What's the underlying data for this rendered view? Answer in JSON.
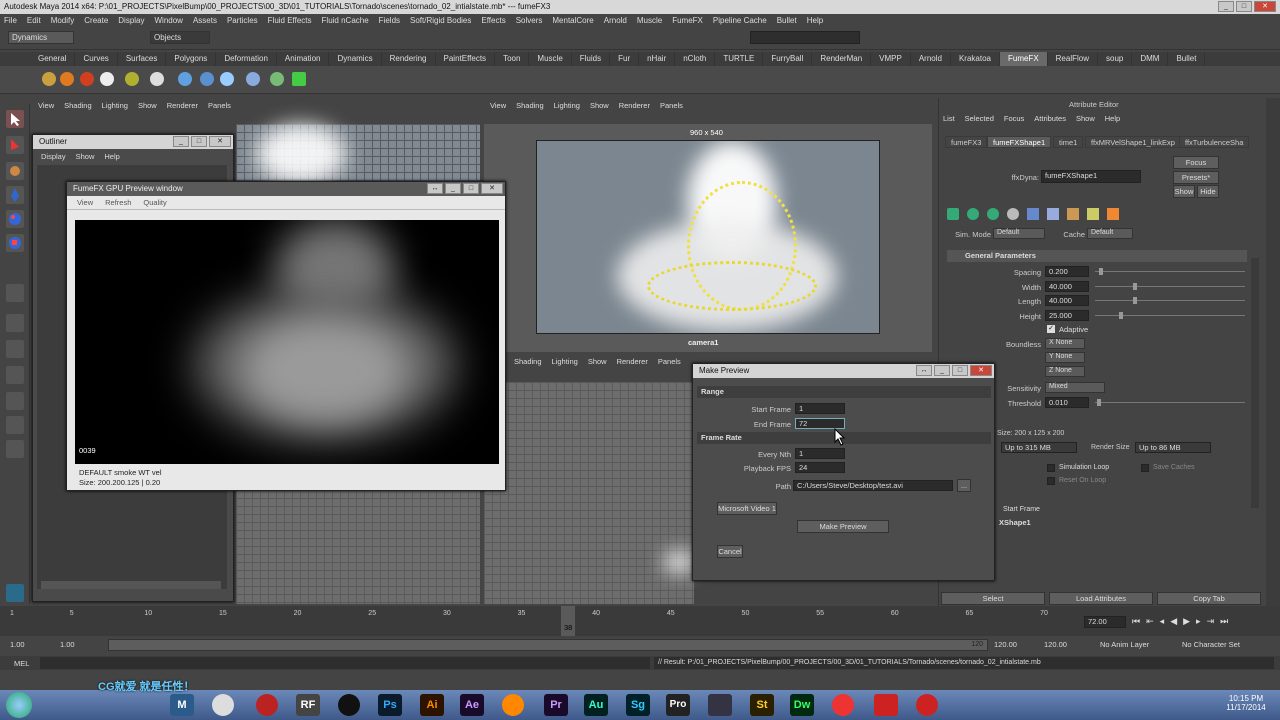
{
  "window_title": "Autodesk Maya 2014 x64: P:\\01_PROJECTS\\PixelBump\\00_PROJECTS\\00_3D\\01_TUTORIALS\\Tornado\\scenes\\tornado_02_intialstate.mb*  ---  fumeFX3",
  "menus": [
    "File",
    "Edit",
    "Modify",
    "Create",
    "Display",
    "Window",
    "Assets",
    "Particles",
    "Fluid Effects",
    "Fluid nCache",
    "Fields",
    "Soft/Rigid Bodies",
    "Effects",
    "Solvers",
    "MentalCore",
    "Arnold",
    "Muscle",
    "FumeFX",
    "Pipeline Cache",
    "Bullet",
    "Help"
  ],
  "status": {
    "menuset": "Dynamics",
    "selection_field": "Objects"
  },
  "shelf_tabs": [
    "General",
    "Curves",
    "Surfaces",
    "Polygons",
    "Deformation",
    "Animation",
    "Dynamics",
    "Rendering",
    "PaintEffects",
    "Toon",
    "Muscle",
    "Fluids",
    "Fur",
    "nHair",
    "nCloth",
    "TURTLE",
    "FurryBall",
    "RenderMan",
    "VMPP",
    "Arnold",
    "Krakatoa",
    "FumeFX",
    "RealFlow",
    "soup",
    "DMM",
    "Bullet"
  ],
  "shelf_active": "FumeFX",
  "panel_menu": [
    "View",
    "Shading",
    "Lighting",
    "Show",
    "Renderer",
    "Panels"
  ],
  "outliner": {
    "title": "Outliner",
    "menu": [
      "Display",
      "Show",
      "Help"
    ]
  },
  "gpu_preview": {
    "title": "FumeFX GPU Preview window",
    "menu": [
      "View",
      "Refresh",
      "Quality"
    ],
    "frame": "0039",
    "info_line1": "DEFAULT smoke WT vel",
    "info_line2": "Size: 200.200.125 | 0.20"
  },
  "camera_view": {
    "resolution": "960 x 540",
    "camera_label": "camera1"
  },
  "attribute_editor": {
    "title": "Attribute Editor",
    "menu": [
      "List",
      "Selected",
      "Focus",
      "Attributes",
      "Show",
      "Help"
    ],
    "tabs": [
      "fumeFX3",
      "fumeFXShape1",
      "time1",
      "ffxMRVelShape1_linkExp",
      "ffxTurbulenceSha"
    ],
    "active_tab": "fumeFXShape1",
    "node_label": "ffxDyna:",
    "node_name": "fumeFXShape1",
    "focus_btn": "Focus",
    "presets_btn": "Presets*",
    "show_btn": "Show",
    "hide_btn": "Hide",
    "sim_mode_label": "Sim. Mode",
    "sim_mode": "Default",
    "cache_label": "Cache",
    "cache": "Default",
    "section": "General Parameters",
    "spacing_label": "Spacing",
    "spacing": "0.200",
    "width_label": "Width",
    "width": "40.000",
    "length_label": "Length",
    "length": "40.000",
    "height_label": "Height",
    "height": "25.000",
    "adaptive": "Adaptive",
    "boundless_label": "Boundless",
    "x_none": "X None",
    "y_none": "Y None",
    "z_none": "Z None",
    "sensitivity_label": "Sensitivity",
    "sensitivity": "Mixed",
    "threshold_label": "Threshold",
    "threshold": "0.010",
    "size_text": "Size: 200 x 125 x 200",
    "upto": "Up to 315 MB",
    "render_size_label": "Render Size",
    "render_upto": "Up to 86 MB",
    "simulation_loop": "Simulation Loop",
    "save_caches": "Save Caches",
    "reset_on_loop": "Reset On Loop",
    "start_frame": "Start Frame",
    "shape_label": "XShape1",
    "select_btn": "Select",
    "load_attr_btn": "Load Attributes",
    "copy_tab_btn": "Copy Tab"
  },
  "make_preview": {
    "title": "Make Preview",
    "range_section": "Range",
    "start_label": "Start Frame",
    "start": "1",
    "end_label": "End Frame",
    "end": "72",
    "framerate_section": "Frame Rate",
    "nth_label": "Every Nth",
    "nth": "1",
    "fps_label": "Playback FPS",
    "fps": "24",
    "path_label": "Path",
    "path": "C:/Users/Steve/Desktop/test.avi",
    "browse": "...",
    "codec_btn": "Microsoft Video 1",
    "make_btn": "Make Preview",
    "cancel_btn": "Cancel"
  },
  "timeline": {
    "ticks": [
      "1",
      "5",
      "10",
      "15",
      "20",
      "25",
      "30",
      "35",
      "40",
      "45",
      "50",
      "55",
      "60",
      "65",
      "70"
    ],
    "current": "38",
    "current_frame_field": "72.00",
    "playback_fraction": 0.52
  },
  "range": {
    "start": "1.00",
    "start2": "1.00",
    "end_marker": "120",
    "end": "120.00",
    "end2": "120.00",
    "anim_layer": "No Anim Layer",
    "char_set": "No Character Set"
  },
  "command": {
    "lang": "MEL",
    "result": "// Result: P:/01_PROJECTS/PixelBump/00_PROJECTS/00_3D/01_TUTORIALS/Tornado/scenes/tornado_02_intialstate.mb"
  },
  "taskbar": {
    "time": "10:15 PM",
    "date": "11/17/2014",
    "watermark": "CG就爱  就是任性！",
    "apps": [
      "Ps",
      "Ai",
      "Ae",
      "Pr",
      "Au",
      "Sg",
      "Pro",
      "St",
      "Dw"
    ]
  }
}
